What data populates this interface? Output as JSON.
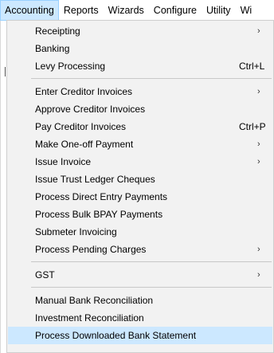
{
  "menubar": {
    "items": [
      "Accounting",
      "Reports",
      "Wizards",
      "Configure",
      "Utility",
      "Wi"
    ]
  },
  "menu": {
    "items": [
      {
        "label": "Receipting",
        "submenu": true
      },
      {
        "label": "Banking"
      },
      {
        "label": "Levy Processing",
        "shortcut": "Ctrl+L"
      },
      {
        "label": "Enter Creditor Invoices",
        "submenu": true
      },
      {
        "label": "Approve Creditor Invoices"
      },
      {
        "label": "Pay Creditor Invoices",
        "shortcut": "Ctrl+P"
      },
      {
        "label": "Make One-off Payment",
        "submenu": true
      },
      {
        "label": "Issue Invoice",
        "submenu": true
      },
      {
        "label": "Issue Trust Ledger Cheques"
      },
      {
        "label": "Process Direct Entry Payments"
      },
      {
        "label": "Process Bulk BPAY Payments"
      },
      {
        "label": "Submeter Invoicing"
      },
      {
        "label": "Process Pending Charges",
        "submenu": true
      },
      {
        "label": "GST",
        "submenu": true
      },
      {
        "label": "Manual Bank Reconciliation"
      },
      {
        "label": "Investment Reconciliation"
      },
      {
        "label": "Process Downloaded Bank Statement",
        "highlighted": true
      }
    ]
  },
  "icons": {
    "submenu_arrow": "chevron-right-icon"
  }
}
